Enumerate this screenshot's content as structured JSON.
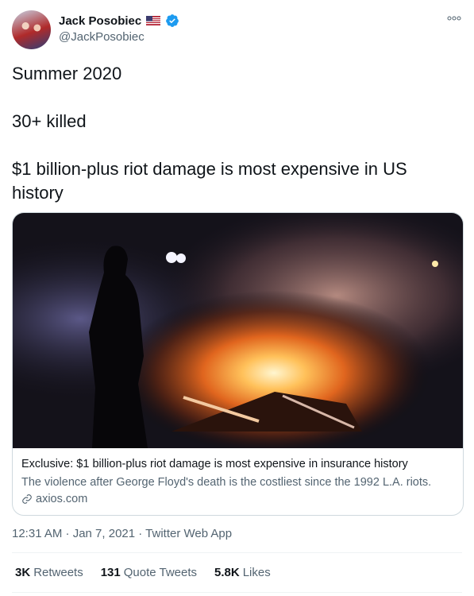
{
  "author": {
    "name": "Jack Posobiec",
    "handle": "@JackPosobiec",
    "flag_icon": "us-flag-icon",
    "verified_icon": "verified-badge-icon"
  },
  "tweet": {
    "lines": [
      "Summer 2020",
      "30+ killed",
      "$1 billion-plus riot damage is most expensive in US",
      "history"
    ]
  },
  "card": {
    "title": "Exclusive: $1 billion-plus riot damage is most expensive in insurance history",
    "description": "The violence after George Floyd's death is the costliest since the 1992 L.A. riots.",
    "domain": "axios.com",
    "link_icon": "link-icon"
  },
  "meta": {
    "time_date_source": "12:31 AM · Jan 7, 2021 · Twitter Web App"
  },
  "stats": {
    "retweets_count": "3K",
    "retweets_label": "Retweets",
    "quotes_count": "131",
    "quotes_label": "Quote Tweets",
    "likes_count": "5.8K",
    "likes_label": "Likes"
  },
  "colors": {
    "text": "#0f1419",
    "secondary": "#536471",
    "verified": "#1d9bf0",
    "border": "#cfd9de"
  }
}
